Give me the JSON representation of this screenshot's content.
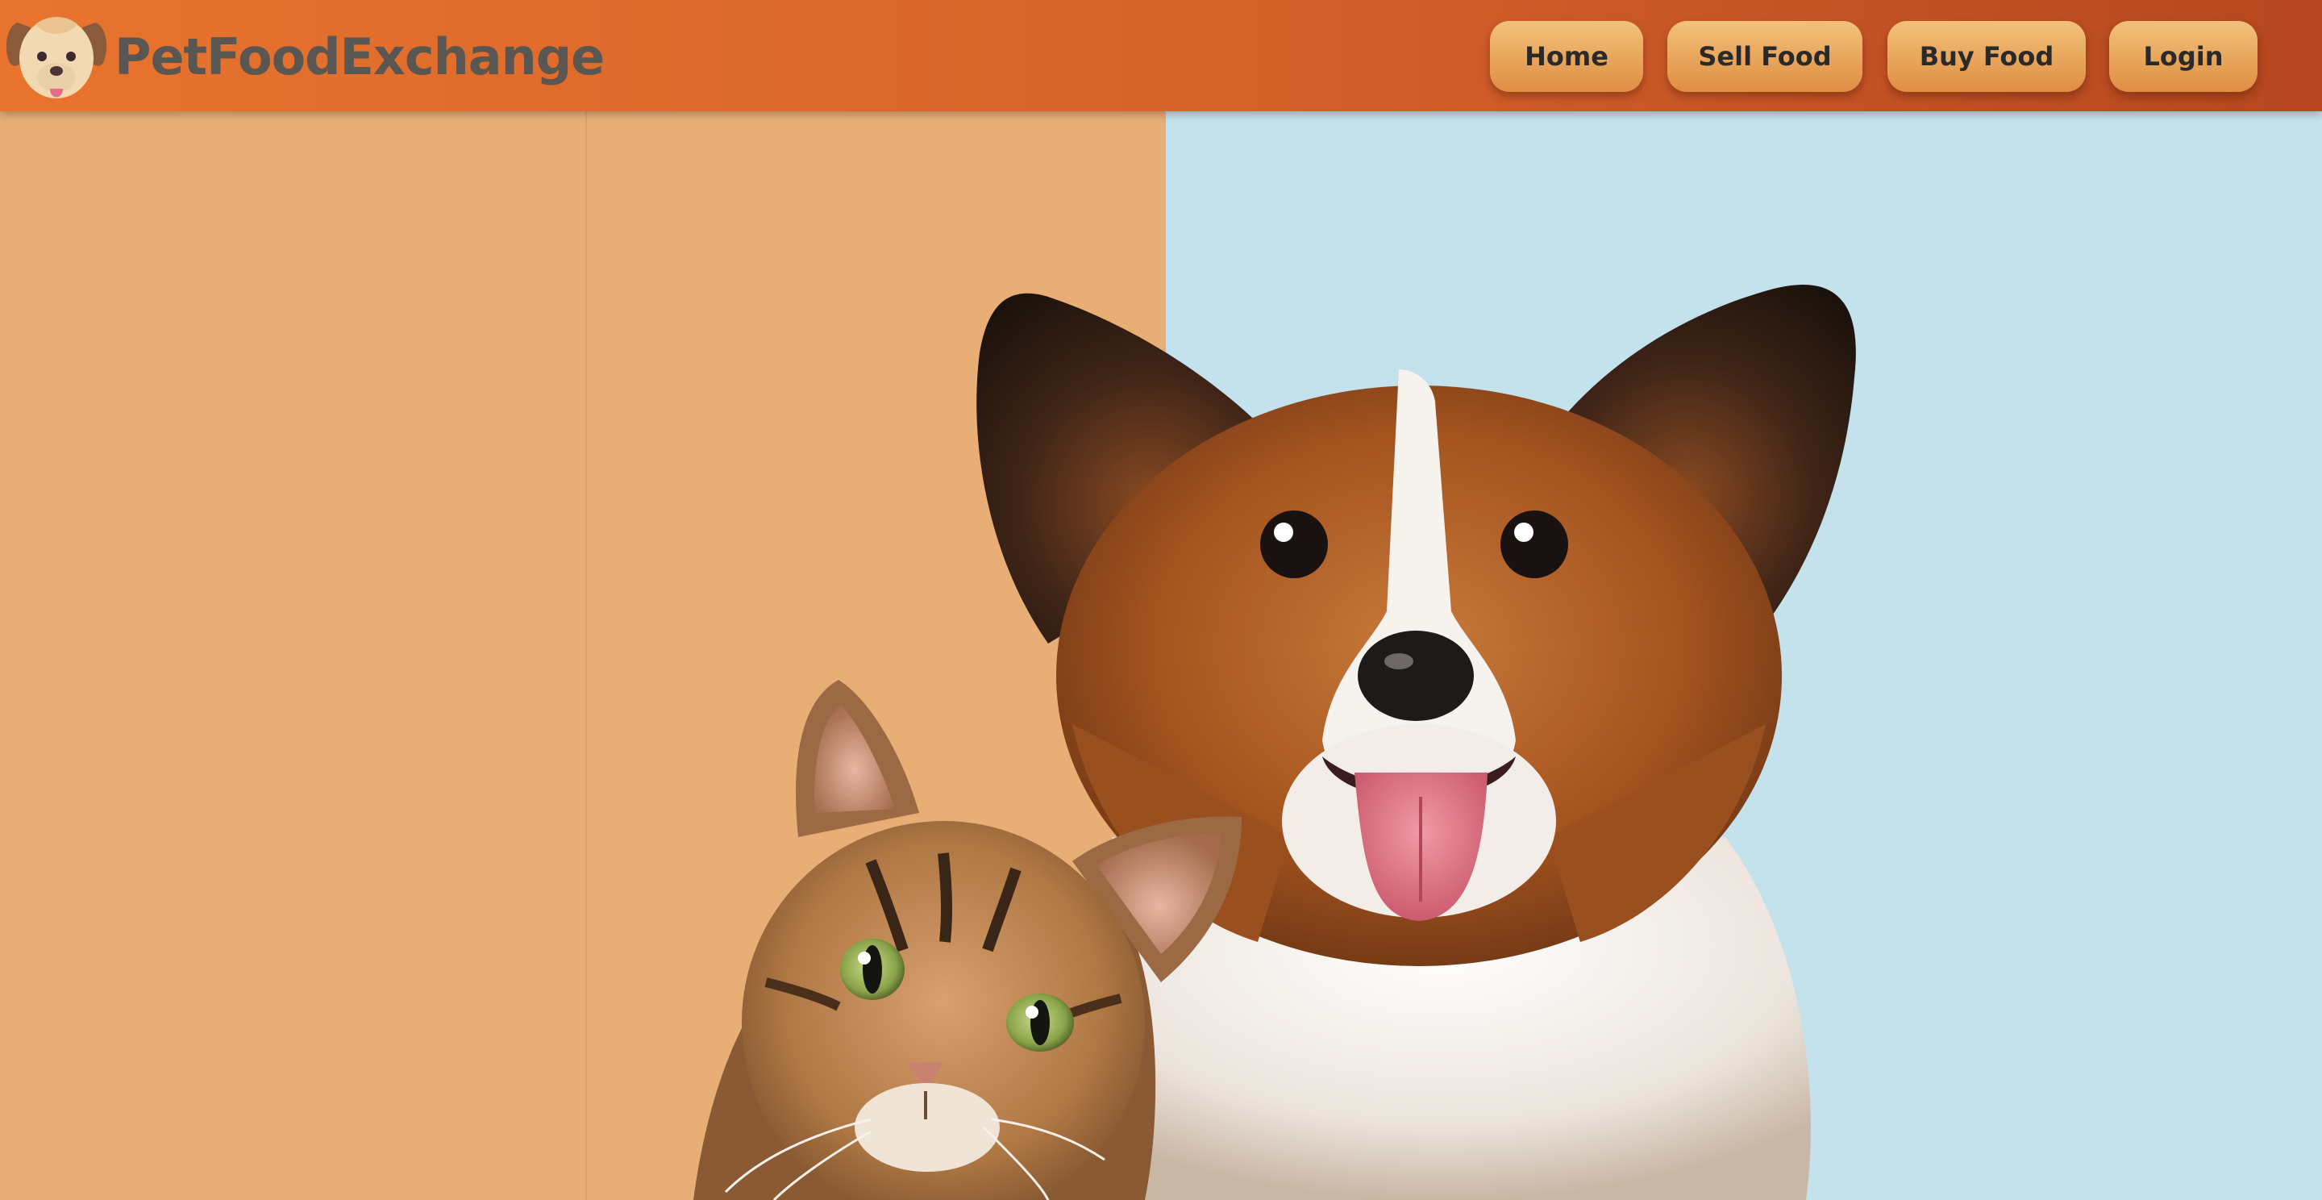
{
  "header": {
    "brand_name": "PetFoodExchange",
    "logo_icon": "dog-face-icon",
    "nav": [
      {
        "label": "Home"
      },
      {
        "label": "Sell Food"
      },
      {
        "label": "Buy Food"
      },
      {
        "label": "Login"
      }
    ]
  },
  "hero": {
    "image_subject": "cat-and-dog-photo"
  },
  "colors": {
    "header_start": "#e8742f",
    "header_end": "#b5461f",
    "button": "#e8a55b",
    "brand_text": "#5a5652",
    "hero_left_bg": "#e8ae76",
    "hero_right_bg": "#c4e2ec"
  }
}
